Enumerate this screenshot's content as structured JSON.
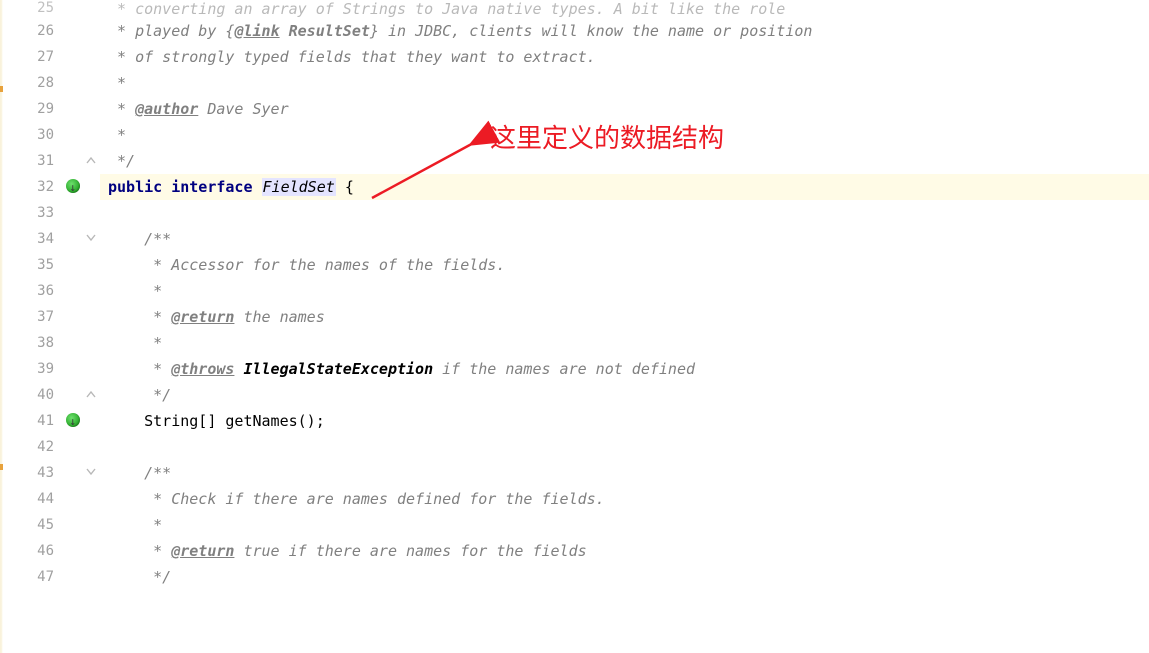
{
  "annotation": {
    "text": "这里定义的数据结构"
  },
  "gutter": {
    "rows": [
      {
        "n": "25",
        "partial": true
      },
      {
        "n": "26"
      },
      {
        "n": "27"
      },
      {
        "n": "28"
      },
      {
        "n": "29"
      },
      {
        "n": "30"
      },
      {
        "n": "31",
        "fold": "close"
      },
      {
        "n": "32",
        "mark": true,
        "arrow": "↓"
      },
      {
        "n": "33"
      },
      {
        "n": "34",
        "fold": "open"
      },
      {
        "n": "35"
      },
      {
        "n": "36"
      },
      {
        "n": "37"
      },
      {
        "n": "38"
      },
      {
        "n": "39"
      },
      {
        "n": "40",
        "fold": "close"
      },
      {
        "n": "41",
        "mark": true,
        "arrow": "↓"
      },
      {
        "n": "42"
      },
      {
        "n": "43",
        "fold": "open"
      },
      {
        "n": "44"
      },
      {
        "n": "45"
      },
      {
        "n": "46"
      },
      {
        "n": "47"
      }
    ]
  },
  "code": {
    "lines": [
      {
        "kind": "comment-partial",
        "text": " * converting an array of Strings to Java native types. A bit like the role"
      },
      {
        "kind": "comment-link",
        "prefix": " * played by {",
        "tag": "@link",
        "link": " ResultSet",
        "suffix": "} in JDBC, clients will know the name or position"
      },
      {
        "kind": "comment",
        "text": " * of strongly typed fields that they want to extract."
      },
      {
        "kind": "comment",
        "text": " *"
      },
      {
        "kind": "comment-tag",
        "prefix": " * ",
        "tag": "@author",
        "rest": " Dave Syer"
      },
      {
        "kind": "comment",
        "text": " *"
      },
      {
        "kind": "comment",
        "text": " */"
      },
      {
        "kind": "decl",
        "hl": true,
        "kw1": "public",
        "kw2": "interface",
        "cls": "FieldSet",
        "brace": "{"
      },
      {
        "kind": "blank"
      },
      {
        "kind": "comment-indent",
        "text": "    /**"
      },
      {
        "kind": "comment-indent",
        "text": "     * Accessor for the names of the fields."
      },
      {
        "kind": "comment-indent",
        "text": "     *"
      },
      {
        "kind": "comment-tag-indent",
        "prefix": "     * ",
        "tag": "@return",
        "rest": " the names"
      },
      {
        "kind": "comment-indent",
        "text": "     *"
      },
      {
        "kind": "comment-throws",
        "prefix": "     * ",
        "tag": "@throws",
        "exc": " IllegalStateException",
        "rest": " if the names are not defined"
      },
      {
        "kind": "comment-indent",
        "text": "     */"
      },
      {
        "kind": "method",
        "indent": "    ",
        "type": "String[] ",
        "name": "getNames",
        "tail": "();"
      },
      {
        "kind": "blank"
      },
      {
        "kind": "comment-indent",
        "text": "    /**"
      },
      {
        "kind": "comment-indent",
        "text": "     * Check if there are names defined for the fields."
      },
      {
        "kind": "comment-indent",
        "text": "     *"
      },
      {
        "kind": "comment-tag-indent",
        "prefix": "     * ",
        "tag": "@return",
        "rest": " true if there are names for the fields"
      },
      {
        "kind": "comment-indent",
        "text": "     */"
      }
    ]
  }
}
